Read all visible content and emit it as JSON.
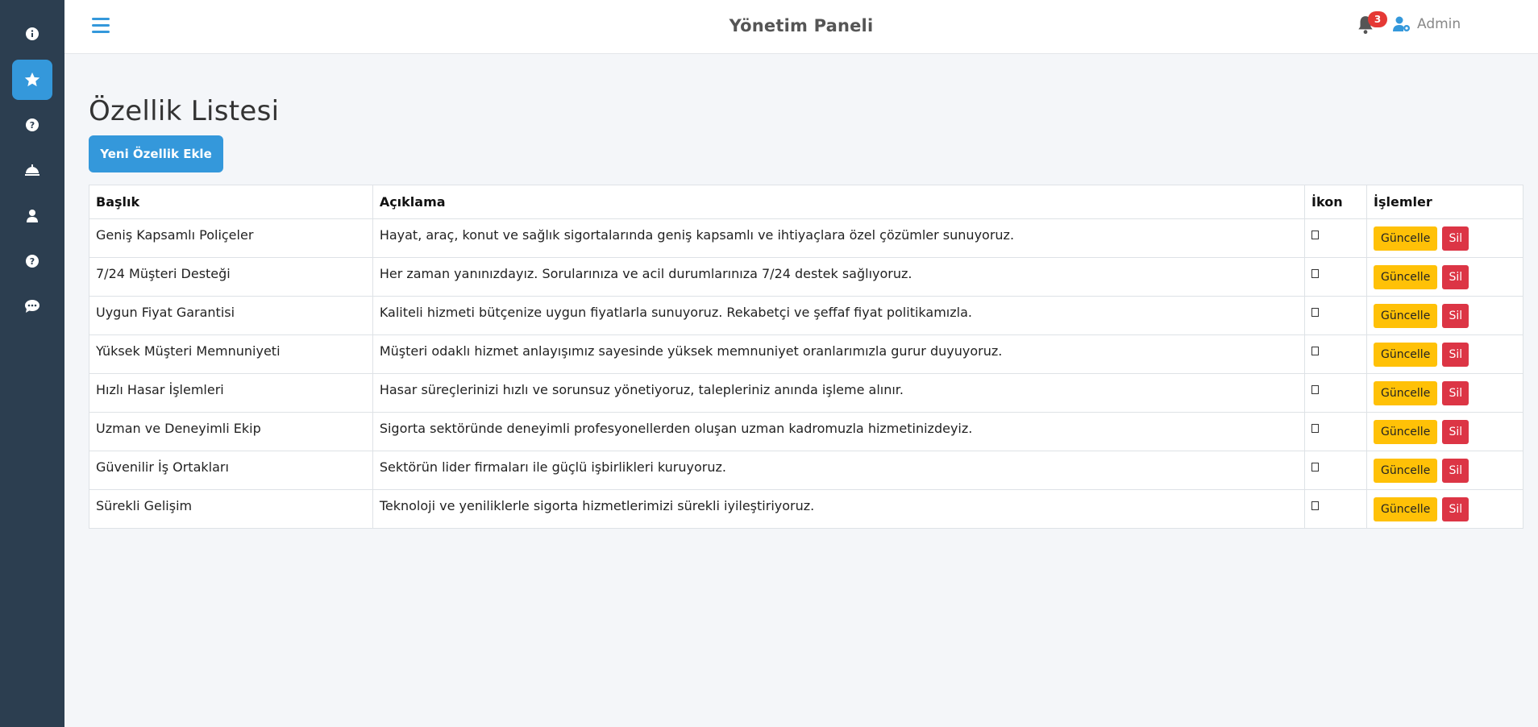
{
  "header": {
    "title": "Yönetim Paneli",
    "notification_count": "3",
    "user_name": "Admin"
  },
  "sidebar": {
    "items": [
      {
        "icon": "info-circle-icon"
      },
      {
        "icon": "star-icon",
        "active": true
      },
      {
        "icon": "question-circle-icon"
      },
      {
        "icon": "concierge-bell-icon"
      },
      {
        "icon": "user-icon"
      },
      {
        "icon": "question-circle-icon"
      },
      {
        "icon": "comment-dots-icon"
      }
    ]
  },
  "main": {
    "page_title": "Özellik Listesi",
    "add_button_label": "Yeni Özellik Ekle",
    "table": {
      "headers": [
        "Başlık",
        "Açıklama",
        "İkon",
        "İşlemler"
      ],
      "update_label": "Güncelle",
      "delete_label": "Sil",
      "rows": [
        {
          "title": "Geniş Kapsamlı Poliçeler",
          "description": "Hayat, araç, konut ve sağlık sigortalarında geniş kapsamlı ve ihtiyaçlara özel çözümler sunuyoruz."
        },
        {
          "title": "7/24 Müşteri Desteği",
          "description": "Her zaman yanınızdayız. Sorularınıza ve acil durumlarınıza 7/24 destek sağlıyoruz."
        },
        {
          "title": "Uygun Fiyat Garantisi",
          "description": "Kaliteli hizmeti bütçenize uygun fiyatlarla sunuyoruz. Rekabetçi ve şeffaf fiyat politikamızla."
        },
        {
          "title": "Yüksek Müşteri Memnuniyeti",
          "description": "Müşteri odaklı hizmet anlayışımız sayesinde yüksek memnuniyet oranlarımızla gurur duyuyoruz."
        },
        {
          "title": "Hızlı Hasar İşlemleri",
          "description": "Hasar süreçlerinizi hızlı ve sorunsuz yönetiyoruz, talepleriniz anında işleme alınır."
        },
        {
          "title": "Uzman ve Deneyimli Ekip",
          "description": "Sigorta sektöründe deneyimli profesyonellerden oluşan uzman kadromuzla hizmetinizdeyiz."
        },
        {
          "title": "Güvenilir İş Ortakları",
          "description": "Sektörün lider firmaları ile güçlü işbirlikleri kuruyoruz."
        },
        {
          "title": "Sürekli Gelişim",
          "description": "Teknoloji ve yeniliklerle sigorta hizmetlerimizi sürekli iyileştiriyoruz."
        }
      ]
    }
  },
  "colors": {
    "sidebar_bg": "#2c3e50",
    "accent": "#3498db",
    "update_button": "#ffc107",
    "delete_button": "#dc3545",
    "badge": "#e53935"
  }
}
